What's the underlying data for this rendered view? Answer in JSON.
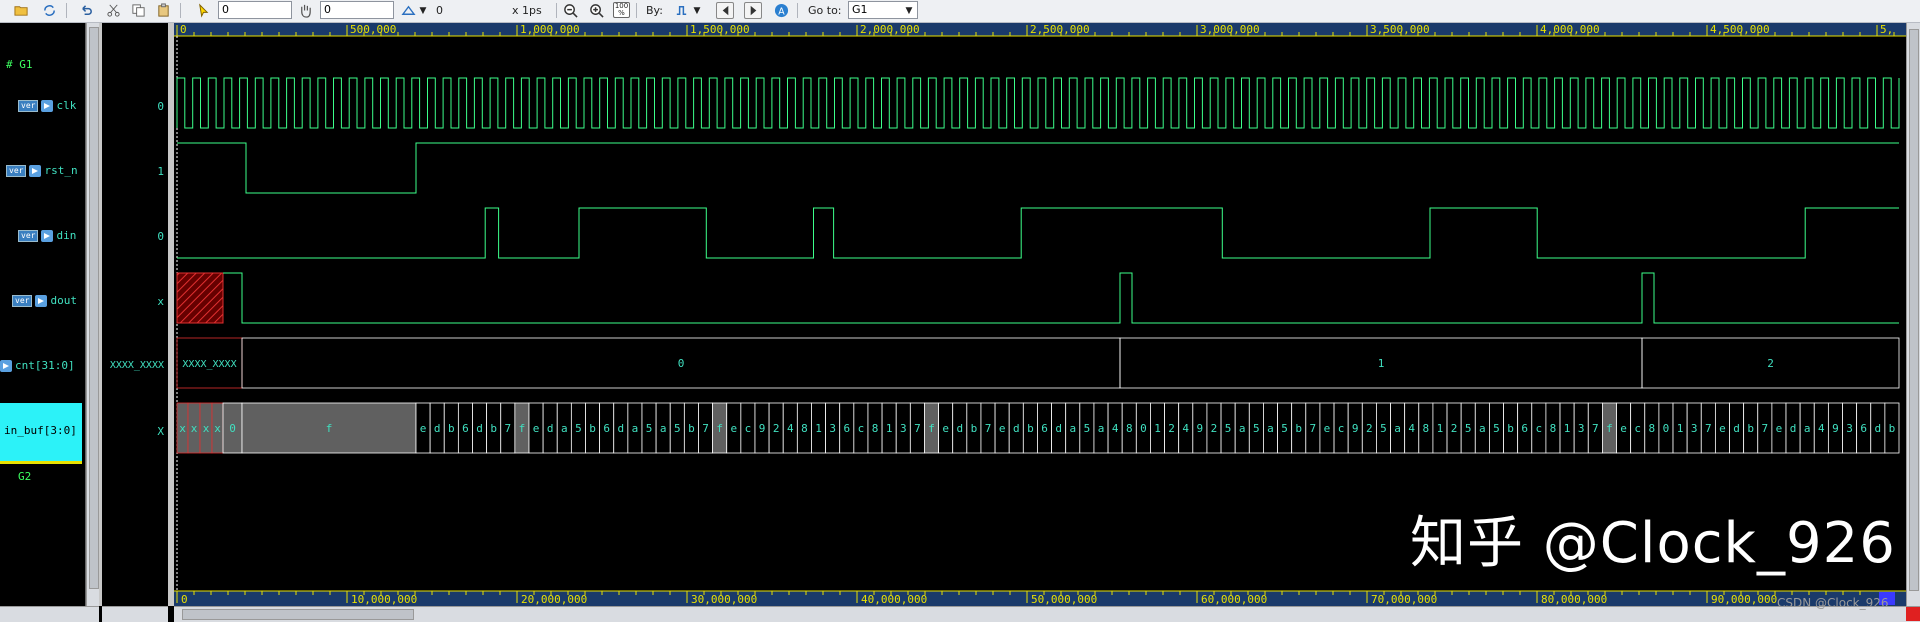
{
  "toolbar": {
    "field_time": "0",
    "field_delta": "0",
    "cursor_value": "0",
    "unit": "x 1ps",
    "zoom_pct": "100 %",
    "by_label": "By:",
    "goto_label": "Go to:",
    "goto_value": "G1",
    "icons": [
      "open-folder-icon",
      "refresh-icon",
      "undo-icon",
      "cut-icon",
      "copy-icon",
      "paste-icon",
      "select-icon",
      "hand-icon",
      "marker-icon",
      "zoom-out-icon",
      "zoom-in-icon",
      "zoom-fit-icon",
      "by-signal-icon",
      "prev-icon",
      "next-icon",
      "search-icon"
    ]
  },
  "signals": {
    "group_top": "# G1",
    "group_bottom": "G2",
    "items": [
      {
        "name": "clk",
        "value": "0",
        "badge": "ver",
        "kind": "bit"
      },
      {
        "name": "rst_n",
        "value": "1",
        "badge": "ver",
        "kind": "bit"
      },
      {
        "name": "din",
        "value": "0",
        "badge": "ver",
        "kind": "bit"
      },
      {
        "name": "dout",
        "value": "x",
        "badge": "ver",
        "kind": "bit"
      },
      {
        "name": "cnt[31:0]",
        "value": "XXXX_XXXX",
        "kind": "bus"
      },
      {
        "name": "in_buf[3:0]",
        "value": "X",
        "kind": "bus",
        "selected": true
      }
    ]
  },
  "timeline": {
    "top_ticks": [
      "0",
      "500,000",
      "1,000,000",
      "1,500,000",
      "2,000,000",
      "2,500,000",
      "3,000,000",
      "3,500,000",
      "4,000,000",
      "4,500,000",
      "5,"
    ],
    "bottom_ticks": [
      "0",
      "10,000,000",
      "20,000,000",
      "30,000,000",
      "40,000,000",
      "50,000,000",
      "60,000,000",
      "70,000,000",
      "80,000,000",
      "90,000,000"
    ]
  },
  "waves": {
    "rst_n_edges": [
      0,
      1,
      0,
      1
    ],
    "din": "00000000000000000000000000000000000000000000001100000000000011111111111111111110000000000000000111000000000000000000000000000011111111111111111111111111111100000000000000000000000000000001111111111111111000000000000000000000000000000000000000011111111111111",
    "cnt_labels": [
      "XXXX_XXXX",
      "0",
      "1",
      "2"
    ],
    "in_buf_labels": [
      "x",
      "x",
      "x",
      "x",
      "0",
      "f",
      "e",
      "d",
      "b",
      "6",
      "d",
      "b",
      "7",
      "f",
      "e",
      "d",
      "a",
      "5",
      "b",
      "6",
      "d",
      "a",
      "5",
      "a",
      "5",
      "b",
      "7",
      "f",
      "e",
      "c",
      "9",
      "2",
      "4",
      "8",
      "1",
      "3",
      "6",
      "c",
      "8",
      "1",
      "3",
      "7",
      "f",
      "e",
      "d",
      "b",
      "7",
      "e",
      "d",
      "b",
      "6",
      "d",
      "a",
      "5",
      "a",
      "4",
      "8",
      "0",
      "1",
      "2",
      "4",
      "9",
      "2",
      "5",
      "a",
      "5",
      "a",
      "5",
      "b",
      "7",
      "e",
      "c",
      "9",
      "2",
      "5",
      "a",
      "4",
      "8",
      "1",
      "2",
      "5",
      "a",
      "5",
      "b",
      "6",
      "c",
      "8",
      "1",
      "3",
      "7",
      "f",
      "e",
      "c",
      "8",
      "0",
      "1",
      "3",
      "7",
      "e",
      "d",
      "b",
      "7",
      "e",
      "d",
      "a",
      "4",
      "9",
      "3",
      "6",
      "d",
      "b"
    ]
  },
  "watermark": "知乎 @Clock_926",
  "csdn": "CSDN @Clock_926"
}
